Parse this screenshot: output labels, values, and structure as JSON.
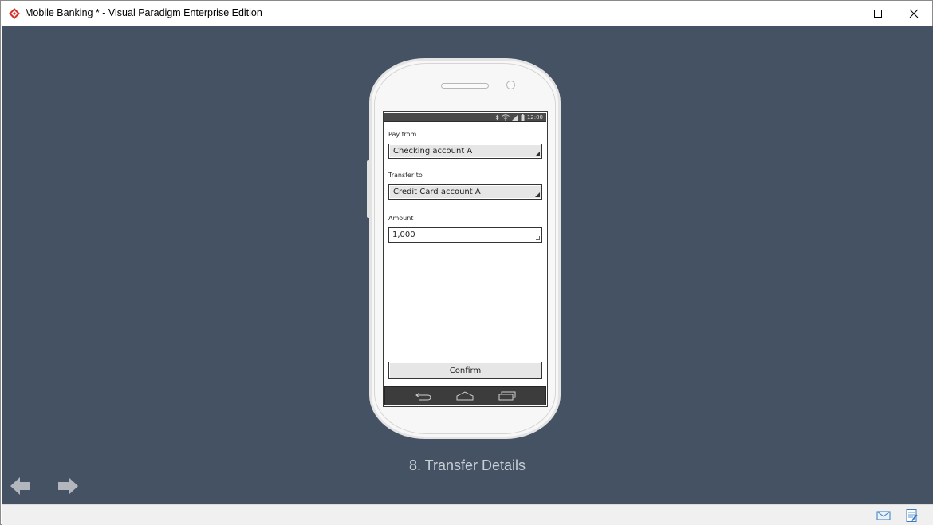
{
  "window": {
    "title": "Mobile Banking * - Visual Paradigm Enterprise Edition"
  },
  "phone": {
    "status_time": "12:00",
    "form": {
      "pay_from_label": "Pay from",
      "pay_from_value": "Checking account A",
      "transfer_to_label": "Transfer to",
      "transfer_to_value": "Credit Card account A",
      "amount_label": "Amount",
      "amount_value": "1,000",
      "confirm_label": "Confirm"
    }
  },
  "slide": {
    "title": "8. Transfer Details"
  },
  "colors": {
    "canvas_bg": "#455263",
    "app_icon": "#d9312b"
  },
  "icons": [
    "app-logo-icon",
    "minimize-icon",
    "maximize-icon",
    "close-icon",
    "bluetooth-icon",
    "wifi-icon",
    "signal-icon",
    "battery-icon",
    "back-icon",
    "home-icon",
    "recent-apps-icon",
    "arrow-left-icon",
    "arrow-right-icon",
    "mail-icon",
    "note-icon"
  ]
}
